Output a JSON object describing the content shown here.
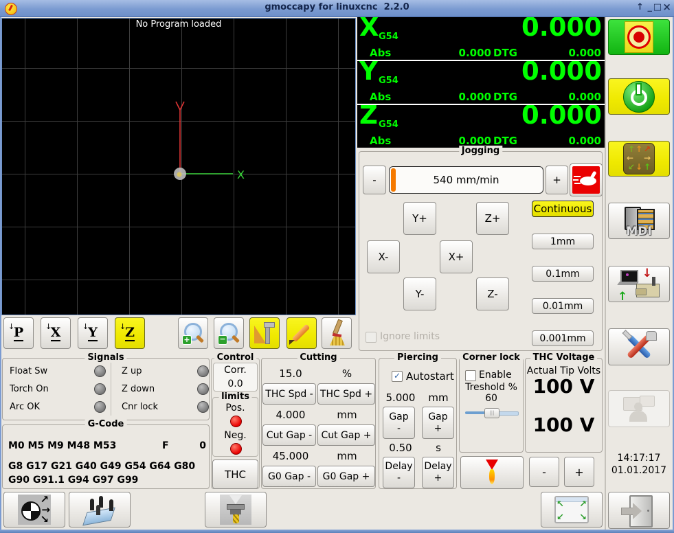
{
  "window": {
    "title": "gmoccapy for linuxcnc  2.2.0",
    "shade": "↑",
    "minimize": "_",
    "maximize": "□",
    "close": "×"
  },
  "preview": {
    "status": "No Program loaded",
    "x_axis_label": "X",
    "toolbar": {
      "p": "P",
      "x": "X",
      "y": "Y",
      "z": "Z"
    }
  },
  "dro": {
    "axes": [
      {
        "letter": "X",
        "system": "G54",
        "abs_label": "Abs",
        "abs_value": "0.000",
        "dtg_label": "DTG",
        "dtg_value": "0.000",
        "value": "0.000"
      },
      {
        "letter": "Y",
        "system": "G54",
        "abs_label": "Abs",
        "abs_value": "0.000",
        "dtg_label": "DTG",
        "dtg_value": "0.000",
        "value": "0.000"
      },
      {
        "letter": "Z",
        "system": "G54",
        "abs_label": "Abs",
        "abs_value": "0.000",
        "dtg_label": "DTG",
        "dtg_value": "0.000",
        "value": "0.000"
      }
    ]
  },
  "jogging": {
    "title": "Jogging",
    "speed_minus": "-",
    "speed": "540 mm/min",
    "speed_plus": "+",
    "jog_buttons": {
      "y_plus": "Y+",
      "z_plus": "Z+",
      "x_minus": "X-",
      "x_plus": "X+",
      "y_minus": "Y-",
      "z_minus": "Z-"
    },
    "increments": {
      "continuous": "Continuous",
      "mm1": "1mm",
      "mm01": "0.1mm",
      "mm001": "0.01mm",
      "mm0001": "0.001mm"
    },
    "ignore_limits": "Ignore limits"
  },
  "signals": {
    "title": "Signals",
    "left": [
      {
        "label": "Float Sw"
      },
      {
        "label": "Torch On"
      },
      {
        "label": "Arc OK"
      }
    ],
    "right": [
      {
        "label": "Z up"
      },
      {
        "label": "Z down"
      },
      {
        "label": "Cnr lock"
      }
    ]
  },
  "gcode": {
    "title": "G-Code",
    "m_codes": "M0 M5 M9 M48 M53",
    "f_label": "F",
    "f_value": "0",
    "g_codes": "G8 G17 G21 G40 G49 G54 G64 G80 G90 G91.1 G94 G97 G99"
  },
  "control": {
    "title": "Control",
    "corr_label": "Corr.",
    "corr_value": "0.0",
    "limits_title": "limits",
    "pos_label": "Pos.",
    "neg_label": "Neg.",
    "thc_button": "THC"
  },
  "cutting": {
    "title": "Cutting",
    "thc_speed": {
      "value": "15.0",
      "unit": "%",
      "minus": "THC Spd -",
      "plus": "THC Spd +"
    },
    "cut_gap": {
      "value": "4.000",
      "unit": "mm",
      "minus": "Cut Gap -",
      "plus": "Cut Gap +"
    },
    "g0_gap": {
      "value": "45.000",
      "unit": "mm",
      "minus": "G0 Gap -",
      "plus": "G0 Gap +"
    }
  },
  "piercing": {
    "title": "Piercing",
    "autostart_label": "Autostart",
    "gap": {
      "value": "5.000",
      "unit": "mm",
      "label": "Gap",
      "minus": "-",
      "plus": "+"
    },
    "delay": {
      "value": "0.50",
      "unit": "s",
      "label": "Delay",
      "minus": "-",
      "plus": "+"
    }
  },
  "corner_lock": {
    "title": "Corner lock",
    "enable_label": "Enable",
    "threshold_label": "Treshold %",
    "threshold_value": "60"
  },
  "thc_voltage": {
    "title": "THC Voltage",
    "subtitle": "Actual Tip Volts",
    "actual": "100 V",
    "setpoint": "100 V",
    "minus": "-",
    "plus": "+"
  },
  "clock": {
    "time": "14:17:17",
    "date": "01.01.2017"
  },
  "right_panel": {
    "mdi_label": "MDI"
  },
  "icons": {
    "check": "✓",
    "arrow_up": "↑",
    "arrow_down": "↓",
    "arrow_left": "←",
    "arrow_right": "→",
    "arrow_ne": "↗",
    "arrow_se": "↘",
    "arrow_nw": "↖",
    "arrow_sw": "↙",
    "zoom_in_sign": "+",
    "zoom_out_sign": "−"
  },
  "colors": {
    "dro_text": "#00ff00",
    "active_button": "#f2ee00",
    "estop_green": "#1fd31f",
    "led_red": "#ff0000",
    "slider_orange": "#f57900",
    "titlebar": "#7b9bd1"
  }
}
